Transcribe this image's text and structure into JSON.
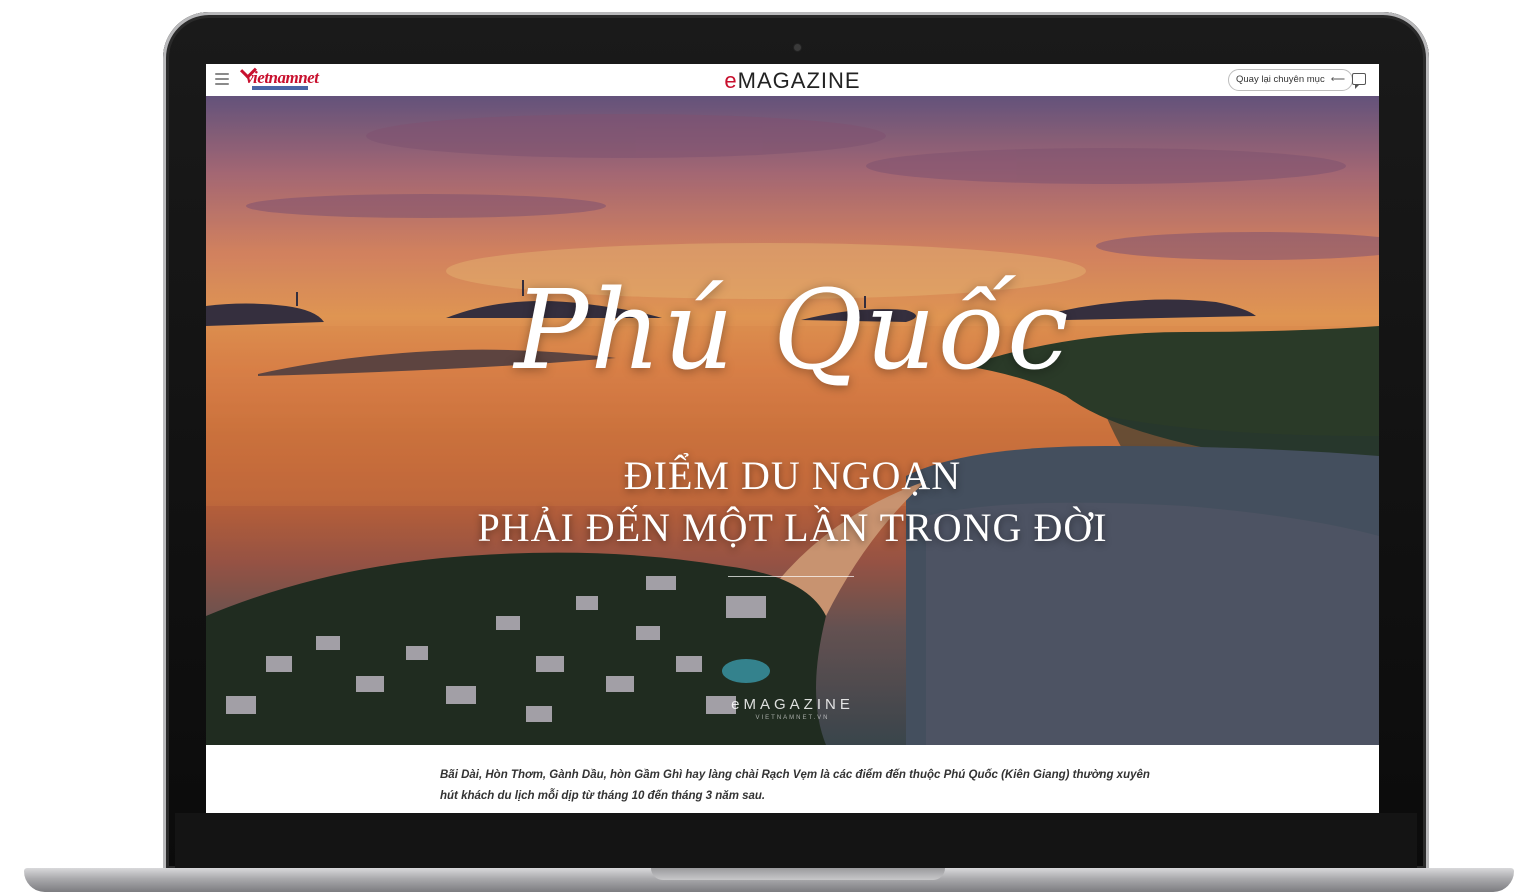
{
  "header": {
    "logo_text": "vietnamnet",
    "brand_prefix": "e",
    "brand_rest": "MAGAZINE",
    "back_label": "Quay lại chuyên mục",
    "back_arrow": "⟵",
    "icons": {
      "menu": "hamburger-icon",
      "comment": "comment-icon",
      "back": "arrow-left-icon"
    }
  },
  "hero": {
    "script_title": "Phú Quốc",
    "subtitle_line1": "ĐIỂM DU NGOẠN",
    "subtitle_line2": "PHẢI ĐẾN MỘT LẦN TRONG ĐỜI",
    "watermark": "eMAGAZINE",
    "watermark_sub": "VIETNAMNET.VN"
  },
  "lead": "Bãi Dài, Hòn Thơm, Gành Dầu, hòn Gầm Ghì hay làng chài Rạch Vẹm là các điểm đến thuộc Phú Quốc (Kiên Giang) thường xuyên hút khách du lịch mỗi dịp từ tháng 10 đến tháng 3 năm sau.",
  "colors": {
    "brand_red": "#c8102e",
    "text": "#333333",
    "frame": "#111111"
  }
}
